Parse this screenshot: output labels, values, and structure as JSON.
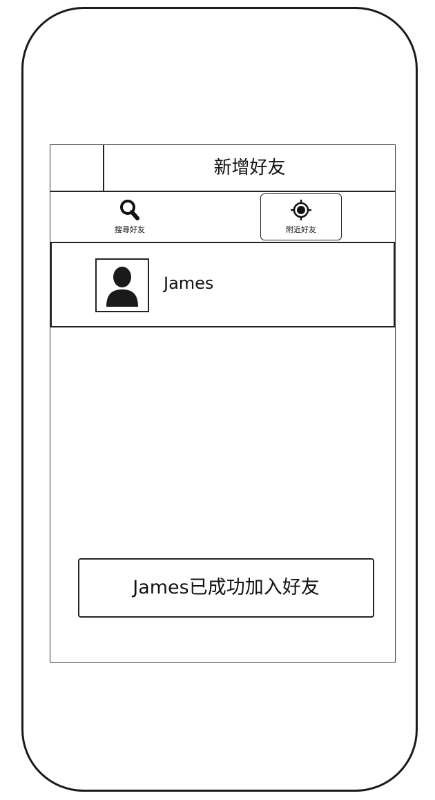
{
  "header": {
    "title": "新增好友"
  },
  "tabs": [
    {
      "label": "搜尋好友",
      "icon": "search-icon"
    },
    {
      "label": "附近好友",
      "icon": "location-target-icon"
    }
  ],
  "friend": {
    "name": "James",
    "avatar_icon": "person-avatar-icon"
  },
  "toast": {
    "message": "James已成功加入好友"
  }
}
